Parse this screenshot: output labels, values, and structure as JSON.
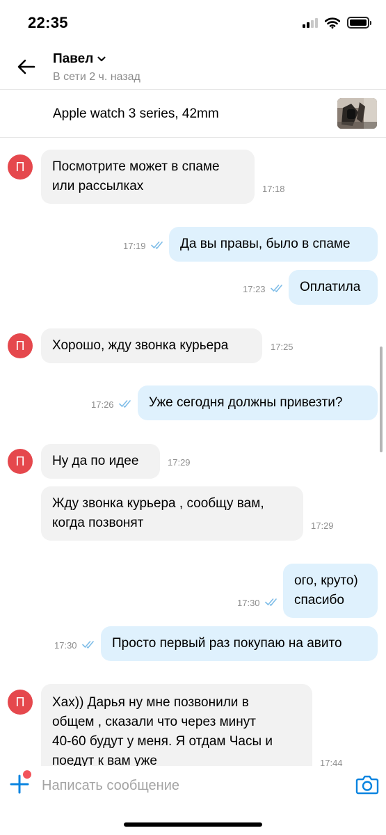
{
  "status_bar": {
    "time": "22:35"
  },
  "header": {
    "contact_name": "Павел",
    "contact_status": "В сети 2 ч. назад"
  },
  "item": {
    "title": "Apple watch 3 series, 42mm"
  },
  "messages": [
    {
      "dir": "in",
      "lines": [
        "Посмотрите может в спаме",
        "или рассылках"
      ],
      "time": "17:18",
      "avatar": "П"
    },
    {
      "dir": "out",
      "lines": [
        "Да вы правы, было в спаме"
      ],
      "time": "17:19",
      "read": true
    },
    {
      "dir": "out",
      "lines": [
        "Оплатила"
      ],
      "time": "17:23",
      "read": true
    },
    {
      "dir": "in",
      "lines": [
        "Хорошо, жду звонка курьера"
      ],
      "time": "17:25",
      "avatar": "П"
    },
    {
      "dir": "out",
      "lines": [
        "Уже сегодня должны привезти?"
      ],
      "time": "17:26",
      "read": true
    },
    {
      "dir": "in",
      "lines": [
        "Ну да по идее"
      ],
      "time": "17:29",
      "avatar": "П"
    },
    {
      "dir": "in",
      "lines": [
        "Жду звонка курьера , сообщу вам,",
        "когда позвонят"
      ],
      "time": "17:29"
    },
    {
      "dir": "out",
      "lines": [
        "ого, круто)",
        "спасибо"
      ],
      "time": "17:30",
      "read": true
    },
    {
      "dir": "out",
      "lines": [
        "Просто первый раз покупаю на авито"
      ],
      "time": "17:30",
      "read": true
    },
    {
      "dir": "in",
      "lines": [
        "Хах)) Дарья ну мне позвонили в",
        "общем , сказали что через минут",
        "40-60 будут у меня. Я отдам Часы и",
        "поедут к вам уже"
      ],
      "time": "17:44",
      "avatar": "П"
    }
  ],
  "input": {
    "placeholder": "Написать сообщение"
  },
  "colors": {
    "accent": "#0a84e0",
    "avatar": "#e5484d",
    "incoming_bubble": "#f2f2f2",
    "outgoing_bubble": "#dff1fd",
    "read_ticks": "#7fbde8"
  },
  "icons": {
    "back": "arrow-left-icon",
    "chevron": "chevron-down-icon",
    "add": "plus-icon",
    "camera": "camera-icon",
    "ticks": "double-check-icon"
  }
}
